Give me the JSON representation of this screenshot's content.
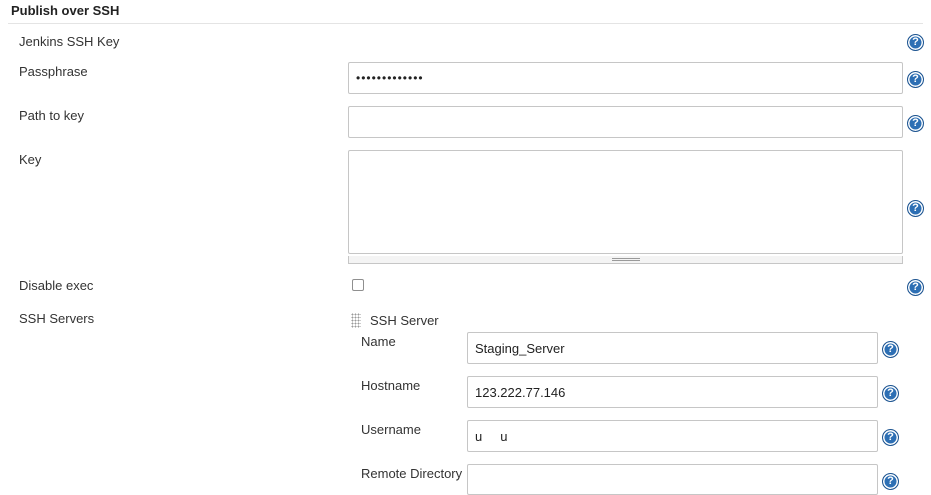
{
  "section": {
    "title": "Publish over SSH"
  },
  "jenkins_ssh_key": {
    "label": "Jenkins SSH Key"
  },
  "passphrase": {
    "label": "Passphrase",
    "value": "•••••••••••••"
  },
  "path_to_key": {
    "label": "Path to key",
    "value": ""
  },
  "key": {
    "label": "Key",
    "value": ""
  },
  "disable_exec": {
    "label": "Disable exec",
    "checked": false
  },
  "ssh_servers": {
    "label": "SSH Servers",
    "server": {
      "title": "SSH Server",
      "name": {
        "label": "Name",
        "value": "Staging_Server"
      },
      "hostname": {
        "label": "Hostname",
        "value": "123.222.77.146"
      },
      "username": {
        "label": "Username",
        "value": "u     u"
      },
      "remote_directory": {
        "label": "Remote Directory",
        "value": ""
      }
    }
  },
  "help": {
    "glyph": "?"
  },
  "colors": {
    "help_blue": "#2d6fb4",
    "border": "#c6c6c6"
  }
}
